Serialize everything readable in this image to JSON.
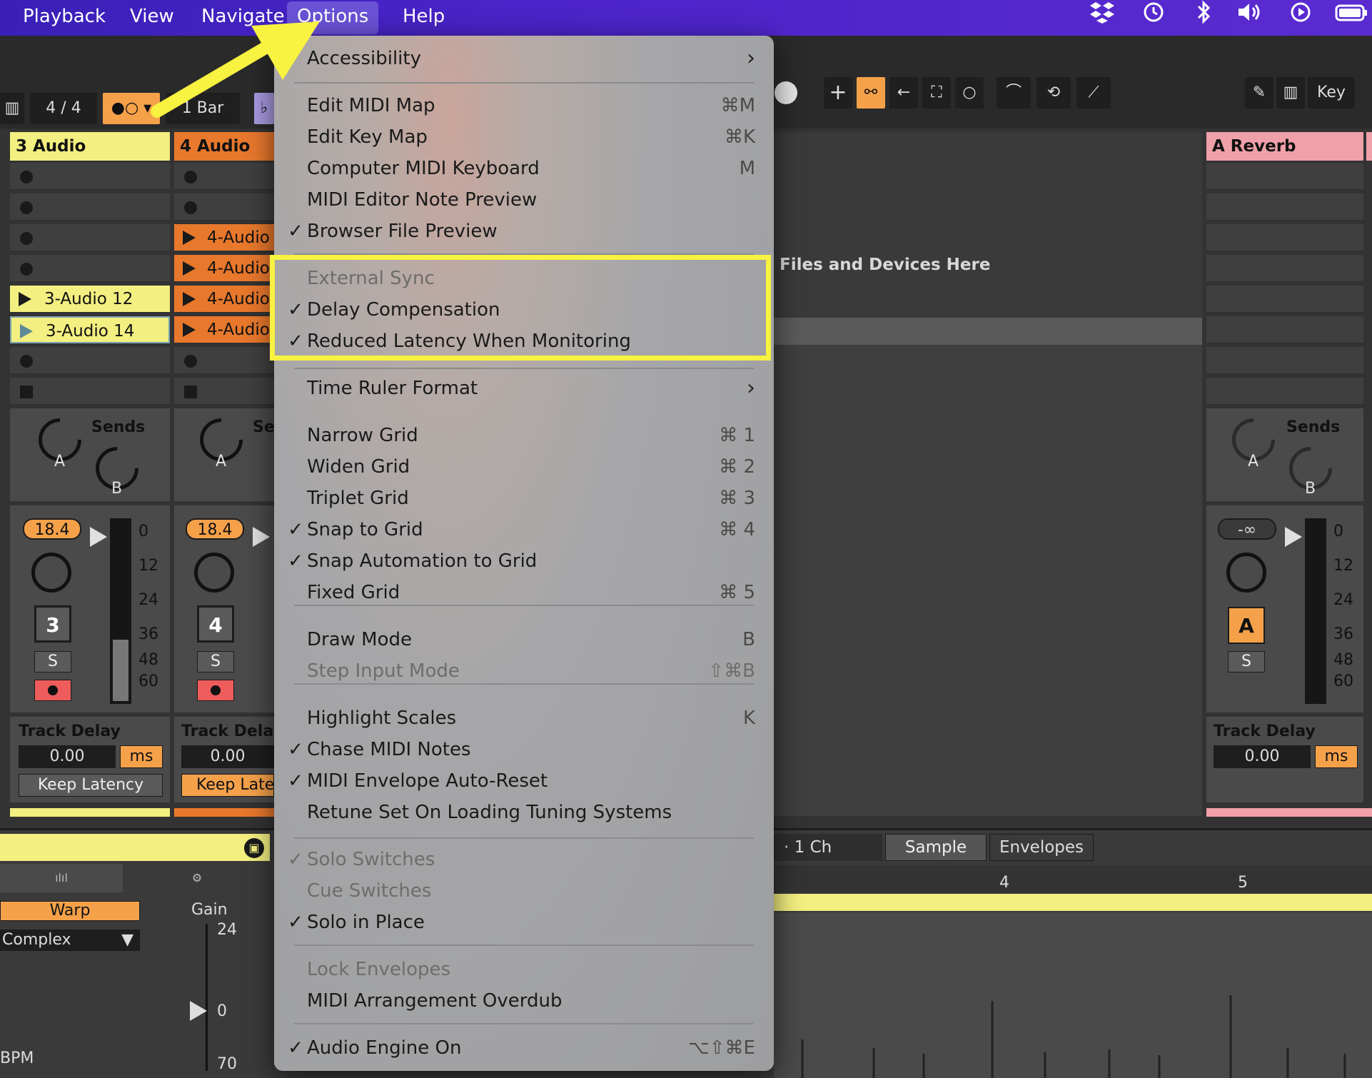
{
  "menubar": {
    "items": [
      "Playback",
      "View",
      "Navigate",
      "Options",
      "Help"
    ],
    "active": "Options"
  },
  "toolbar": {
    "time_signature": "4 / 4",
    "bar_label": "1 Bar",
    "key_label": "Key"
  },
  "tracks": {
    "t3": {
      "header": "3 Audio",
      "clips": [
        "3-Audio 12",
        "3-Audio 14"
      ],
      "sends_label": "Sends",
      "send_a": "A",
      "send_b": "B",
      "volume": "18.4",
      "number": "3",
      "solo": "S",
      "meter_ticks": [
        "0",
        "12",
        "24",
        "36",
        "48",
        "60"
      ],
      "track_delay_label": "Track Delay",
      "track_delay_value": "0.00",
      "track_delay_unit": "ms",
      "keep_latency": "Keep Latency"
    },
    "t4": {
      "header": "4 Audio",
      "clip_label": "4-Audio",
      "sends_label": "Se",
      "send_a": "A",
      "volume": "18.4",
      "number": "4",
      "solo": "S",
      "track_delay_label": "Track Delay",
      "track_delay_value": "0.00",
      "keep_latency": "Keep Late"
    },
    "reverb": {
      "header": "A Reverb",
      "sends_label": "Sends",
      "send_a": "A",
      "send_b": "B",
      "volume": "-∞",
      "number": "A",
      "solo": "S",
      "meter_ticks": [
        "0",
        "12",
        "24",
        "36",
        "48",
        "60"
      ],
      "track_delay_label": "Track Delay",
      "track_delay_value": "0.00",
      "track_delay_unit": "ms"
    }
  },
  "drop_hint": "Files and Devices Here",
  "clip_view": {
    "warp": "Warp",
    "warp_mode": "Complex",
    "gain_label": "Gain",
    "gain_ticks": [
      "24",
      "0",
      "70"
    ],
    "bpm_label": "BPM",
    "channel": "1 Ch",
    "tab_sample": "Sample",
    "tab_envelopes": "Envelopes",
    "ruler": [
      "4",
      "5"
    ]
  },
  "menu": {
    "items": [
      {
        "label": "Accessibility",
        "submenu": true
      },
      {
        "label": "Edit MIDI Map",
        "shortcut": "⌘M"
      },
      {
        "label": "Edit Key Map",
        "shortcut": "⌘K"
      },
      {
        "label": "Computer MIDI Keyboard",
        "shortcut": "M"
      },
      {
        "label": "MIDI Editor Note Preview"
      },
      {
        "label": "Browser File Preview",
        "checked": true
      },
      {
        "label": "External Sync",
        "disabled": true
      },
      {
        "label": "Delay Compensation",
        "checked": true
      },
      {
        "label": "Reduced Latency When Monitoring",
        "checked": true
      },
      {
        "label": "Time Ruler Format",
        "submenu": true
      },
      {
        "label": "Narrow Grid",
        "shortcut": "⌘ 1"
      },
      {
        "label": "Widen Grid",
        "shortcut": "⌘ 2"
      },
      {
        "label": "Triplet Grid",
        "shortcut": "⌘ 3"
      },
      {
        "label": "Snap to Grid",
        "shortcut": "⌘ 4",
        "checked": true
      },
      {
        "label": "Snap Automation to Grid",
        "checked": true
      },
      {
        "label": "Fixed Grid",
        "shortcut": "⌘ 5"
      },
      {
        "label": "Draw Mode",
        "shortcut": "B"
      },
      {
        "label": "Step Input Mode",
        "shortcut": "⇧⌘B",
        "disabled": true
      },
      {
        "label": "Highlight Scales",
        "shortcut": "K"
      },
      {
        "label": "Chase MIDI Notes",
        "checked": true
      },
      {
        "label": "MIDI Envelope Auto-Reset",
        "checked": true
      },
      {
        "label": "Retune Set On Loading Tuning Systems"
      },
      {
        "label": "Solo Switches",
        "checked": true,
        "disabled": true
      },
      {
        "label": "Cue Switches",
        "disabled": true
      },
      {
        "label": "Solo in Place",
        "checked": true
      },
      {
        "label": "Lock Envelopes",
        "disabled": true
      },
      {
        "label": "MIDI Arrangement Overdub"
      },
      {
        "label": "Audio Engine On",
        "shortcut": "⌥⇧⌘E",
        "checked": true
      }
    ],
    "check_glyph": "✓",
    "submenu_glyph": "›"
  },
  "colors": {
    "menubar": "#4b24c9",
    "yellow_track": "#f3ef80",
    "orange_track": "#e8782c",
    "reverb_track": "#f0a0a8",
    "annotation": "#f8f240"
  }
}
